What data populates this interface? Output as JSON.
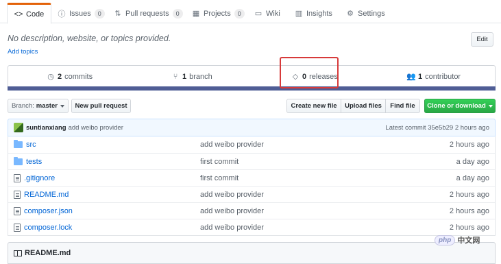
{
  "tabs": [
    {
      "label": "Code",
      "icon": "code-icon",
      "active": true
    },
    {
      "label": "Issues",
      "icon": "issue-icon",
      "count": "0"
    },
    {
      "label": "Pull requests",
      "icon": "pull-request-icon",
      "count": "0"
    },
    {
      "label": "Projects",
      "icon": "project-icon",
      "count": "0"
    },
    {
      "label": "Wiki",
      "icon": "book-icon"
    },
    {
      "label": "Insights",
      "icon": "graph-icon"
    },
    {
      "label": "Settings",
      "icon": "gear-icon"
    }
  ],
  "repo": {
    "description": "No description, website, or topics provided.",
    "add_topics": "Add topics",
    "edit_label": "Edit"
  },
  "summary": {
    "commits_count": "2",
    "commits_label": "commits",
    "branch_count": "1",
    "branch_label": "branch",
    "releases_count": "0",
    "releases_label": "releases",
    "contributors_count": "1",
    "contributors_label": "contributor"
  },
  "toolbar": {
    "branch_prefix": "Branch:",
    "branch_name": "master",
    "new_pr": "New pull request",
    "create_file": "Create new file",
    "upload_files": "Upload files",
    "find_file": "Find file",
    "clone": "Clone or download"
  },
  "commit": {
    "user": "suntianxiang",
    "message": "add weibo provider",
    "latest": "Latest commit 35e5b29 2 hours ago"
  },
  "files": [
    {
      "name": "src",
      "type": "dir",
      "message": "add weibo provider",
      "age": "2 hours ago"
    },
    {
      "name": "tests",
      "type": "dir",
      "message": "first commit",
      "age": "a day ago"
    },
    {
      "name": ".gitignore",
      "type": "file",
      "message": "first commit",
      "age": "a day ago"
    },
    {
      "name": "README.md",
      "type": "file",
      "message": "add weibo provider",
      "age": "2 hours ago"
    },
    {
      "name": "composer.json",
      "type": "file",
      "message": "add weibo provider",
      "age": "2 hours ago"
    },
    {
      "name": "composer.lock",
      "type": "file",
      "message": "add weibo provider",
      "age": "2 hours ago"
    }
  ],
  "readme": {
    "title": "README.md"
  },
  "watermark": {
    "badge": "php",
    "text": "中文网"
  },
  "colors": {
    "accent": "#0366d6",
    "clone_green": "#28a745",
    "language_bar": "#4f5d95",
    "highlight": "#d73a3a"
  }
}
